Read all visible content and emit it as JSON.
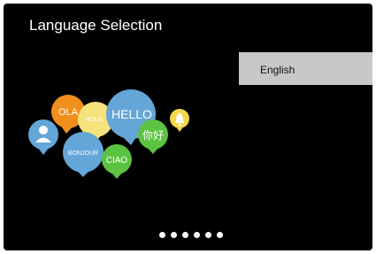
{
  "header": {
    "title": "Language Selection"
  },
  "languages": {
    "selected": "English"
  },
  "illustration": {
    "greetings": [
      "OLA",
      "HOLA",
      "HELLO",
      "你好",
      "BONJOUR",
      "CIAO"
    ]
  },
  "pager": {
    "count": 6
  },
  "colors": {
    "background": "#000000",
    "selected_row": "#c8c8c8",
    "orange": "#f0901c",
    "yellow": "#f6e27a",
    "blue": "#64a6d8",
    "green": "#5cc241",
    "bell_yellow": "#f6d64a"
  }
}
